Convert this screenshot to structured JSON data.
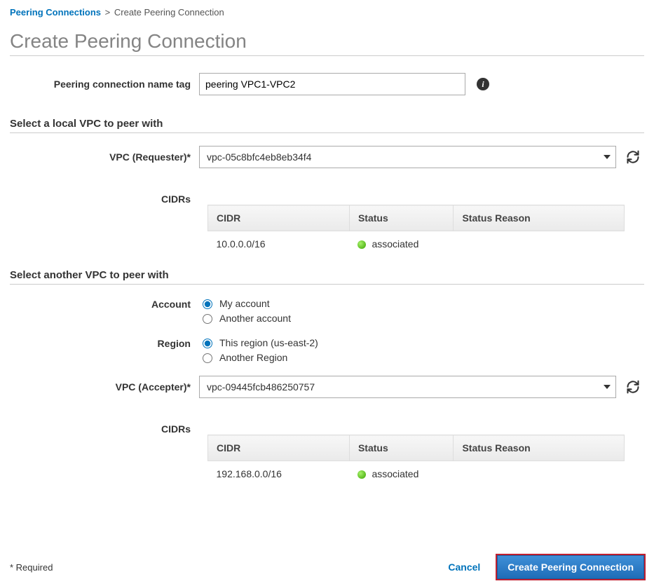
{
  "breadcrumb": {
    "parent": "Peering Connections",
    "current": "Create Peering Connection"
  },
  "title": "Create Peering Connection",
  "name_tag": {
    "label": "Peering connection name tag",
    "value": "peering VPC1-VPC2"
  },
  "local": {
    "heading": "Select a local VPC to peer with",
    "vpc_label": "VPC (Requester)*",
    "vpc_value": "vpc-05c8bfc4eb8eb34f4",
    "cidrs_label": "CIDRs",
    "table": {
      "cols": {
        "cidr": "CIDR",
        "status": "Status",
        "reason": "Status Reason"
      },
      "row": {
        "cidr": "10.0.0.0/16",
        "status": "associated",
        "reason": ""
      }
    }
  },
  "other": {
    "heading": "Select another VPC to peer with",
    "account_label": "Account",
    "account_opts": {
      "mine": "My account",
      "other": "Another account"
    },
    "region_label": "Region",
    "region_opts": {
      "this": "This region (us-east-2)",
      "other": "Another Region"
    },
    "vpc_label": "VPC (Accepter)*",
    "vpc_value": "vpc-09445fcb486250757",
    "cidrs_label": "CIDRs",
    "table": {
      "cols": {
        "cidr": "CIDR",
        "status": "Status",
        "reason": "Status Reason"
      },
      "row": {
        "cidr": "192.168.0.0/16",
        "status": "associated",
        "reason": ""
      }
    }
  },
  "footer": {
    "required": "* Required",
    "cancel": "Cancel",
    "create": "Create Peering Connection"
  }
}
